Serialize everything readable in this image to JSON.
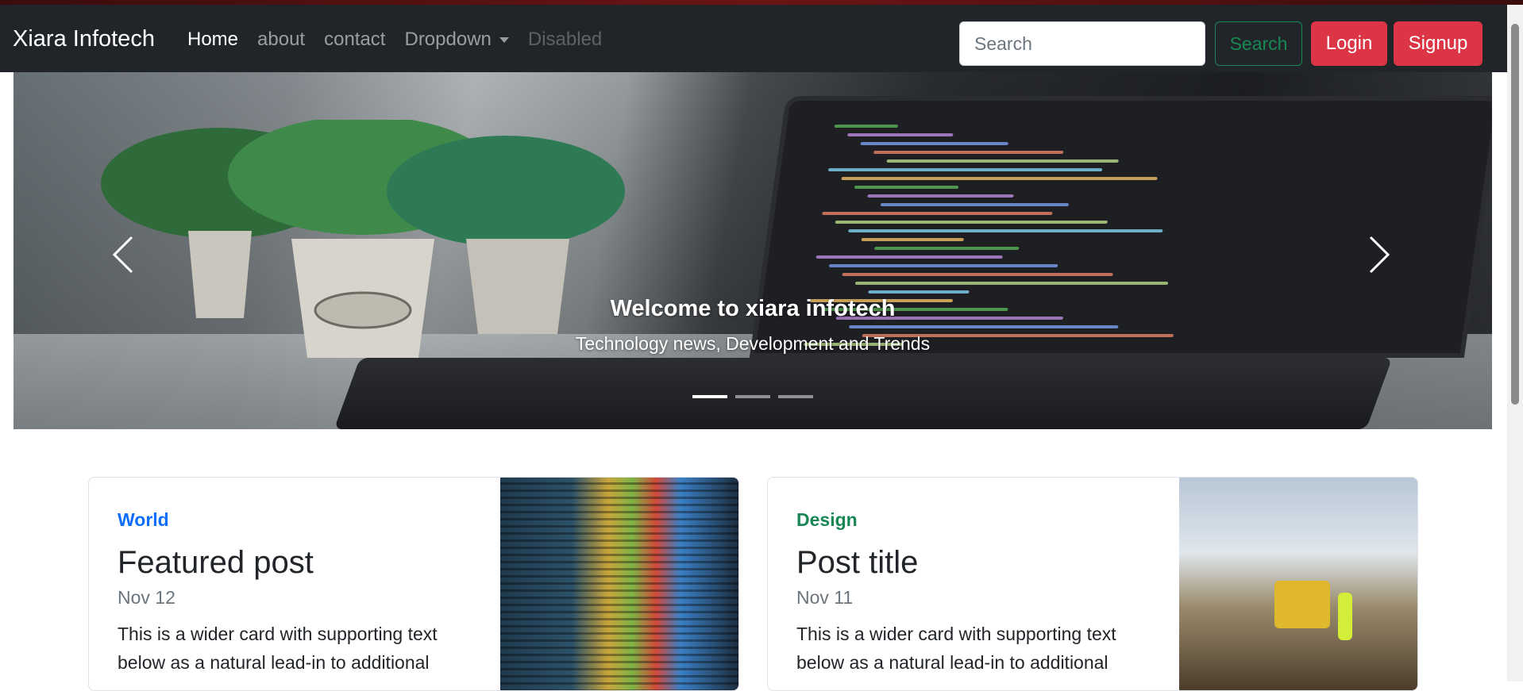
{
  "navbar": {
    "brand": "Xiara Infotech",
    "links": [
      {
        "label": "Home",
        "state": "active"
      },
      {
        "label": "about",
        "state": "normal"
      },
      {
        "label": "contact",
        "state": "normal"
      },
      {
        "label": "Dropdown",
        "state": "dropdown"
      },
      {
        "label": "Disabled",
        "state": "disabled"
      }
    ],
    "search_placeholder": "Search",
    "search_value": "",
    "search_button": "Search",
    "login_button": "Login",
    "signup_button": "Signup"
  },
  "carousel": {
    "caption_title": "Welcome to xiara infotech",
    "caption_subtitle": "Technology news, Development and Trends",
    "prev_icon": "chevron-left-icon",
    "next_icon": "chevron-right-icon",
    "slide_count": 3,
    "active_slide": 1
  },
  "cards": [
    {
      "category": "World",
      "title": "Featured post",
      "date": "Nov 12",
      "text": "This is a wider card with supporting text below as a natural lead-in to additional",
      "category_color": "#0d6efd"
    },
    {
      "category": "Design",
      "title": "Post title",
      "date": "Nov 11",
      "text": "This is a wider card with supporting text below as a natural lead-in to additional",
      "category_color": "#198754"
    }
  ],
  "colors": {
    "navbar_bg": "#212529",
    "danger": "#dc3545",
    "success": "#198754",
    "primary": "#0d6efd"
  }
}
